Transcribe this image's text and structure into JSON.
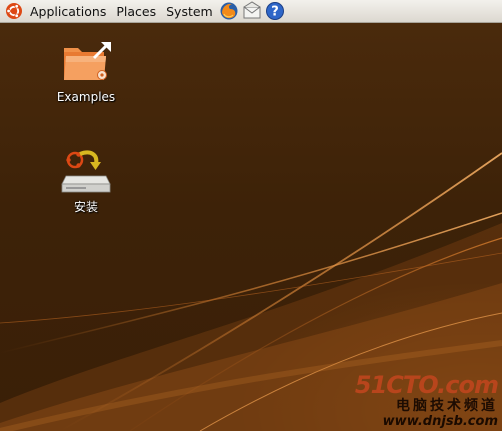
{
  "panel": {
    "menus": [
      "Applications",
      "Places",
      "System"
    ],
    "launchers": [
      "firefox-icon",
      "mail-icon",
      "help-icon"
    ]
  },
  "desktop": {
    "icons": [
      {
        "label": "Examples",
        "icon": "examples-folder-icon"
      },
      {
        "label": "安装",
        "icon": "install-drive-icon"
      }
    ]
  },
  "watermark": {
    "brand": "51CTO.com",
    "subtitle": "电脑技术频道",
    "site": "www.dnjsb.com"
  },
  "colors": {
    "panel": "#e8e5df",
    "desktop_brown": "#3d2208",
    "folder_orange": "#f08a3e",
    "ubuntu_orange": "#dd4814"
  }
}
